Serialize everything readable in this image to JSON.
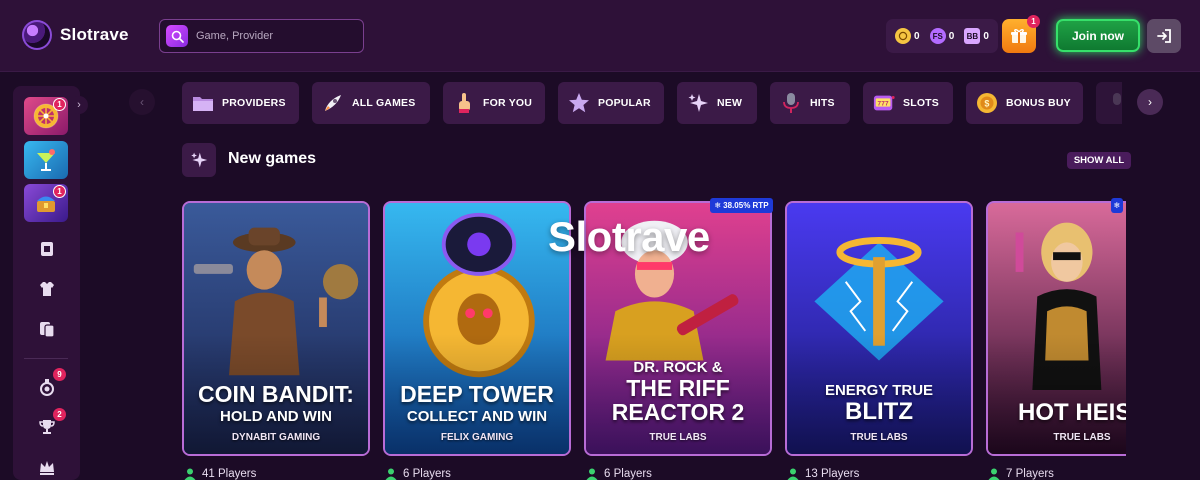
{
  "header": {
    "brand": "Slotrave",
    "search_placeholder": "Game, Provider",
    "currencies": [
      {
        "icon": "coin-icon",
        "value": "0",
        "color": "#f5c542"
      },
      {
        "icon": "freespin-icon",
        "label": "FS",
        "value": "0",
        "color": "#b36bff"
      },
      {
        "icon": "bonus-balance-icon",
        "label": "BB",
        "value": "0",
        "color": "#d9a6ff"
      }
    ],
    "gift_badge": "1",
    "join_label": "Join now"
  },
  "sidebar": {
    "tiles": [
      {
        "name": "wheel",
        "badge": "1",
        "color": "#c0306a"
      },
      {
        "name": "cocktail",
        "badge": "",
        "color": "#2a8fd8"
      },
      {
        "name": "treasure",
        "badge": "1",
        "color": "#6d2fb0"
      }
    ],
    "icons": [
      {
        "name": "card-icon",
        "badge": ""
      },
      {
        "name": "shirt-icon",
        "badge": ""
      },
      {
        "name": "cards-icon",
        "badge": ""
      },
      {
        "name": "medal-icon",
        "badge": "9"
      },
      {
        "name": "trophy-icon",
        "badge": "2"
      },
      {
        "name": "crown-icon",
        "badge": ""
      }
    ]
  },
  "categories": [
    {
      "label": "PROVIDERS",
      "icon": "folder-icon"
    },
    {
      "label": "ALL GAMES",
      "icon": "rocket-icon"
    },
    {
      "label": "FOR YOU",
      "icon": "pointing-hand-icon"
    },
    {
      "label": "POPULAR",
      "icon": "star-icon"
    },
    {
      "label": "NEW",
      "icon": "sparkles-icon"
    },
    {
      "label": "HITS",
      "icon": "microphone-icon"
    },
    {
      "label": "SLOTS",
      "icon": "slot-machine-icon"
    },
    {
      "label": "BONUS BUY",
      "icon": "coin-icon"
    }
  ],
  "section": {
    "title": "New games",
    "show_all": "SHOW ALL"
  },
  "watermark": "Slotrave",
  "games": [
    {
      "title_lines": [
        "COIN BANDIT:",
        "HOLD AND WIN"
      ],
      "provider": "DYNABIT GAMING",
      "players": "41 Players",
      "rtp": "",
      "colors": [
        "#2c4a8a",
        "#0f1a3a"
      ]
    },
    {
      "title_lines": [
        "DEEP TOWER",
        "COLLECT AND WIN"
      ],
      "provider": "FELIX GAMING",
      "players": "6 Players",
      "rtp": "",
      "colors": [
        "#1f9fe0",
        "#0a3f8a"
      ]
    },
    {
      "title_lines": [
        "DR. ROCK &",
        "THE RIFF",
        "REACTOR 2"
      ],
      "provider": "TRUE LABS",
      "players": "6 Players",
      "rtp": "38.05% RTP",
      "colors": [
        "#d2358a",
        "#5a1a8a"
      ]
    },
    {
      "title_lines": [
        "ENERGY TRUE",
        "BLITZ"
      ],
      "provider": "TRUE LABS",
      "players": "13 Players",
      "rtp": "",
      "colors": [
        "#3a3ad8",
        "#12126a"
      ]
    },
    {
      "title_lines": [
        "HOT HEIST"
      ],
      "provider": "TRUE LABS",
      "players": "7 Players",
      "rtp": "",
      "colors": [
        "#c84a8a",
        "#3a0f3a"
      ]
    }
  ],
  "colors": {
    "background": "#1c0b26",
    "panel": "#2e1138",
    "chip": "#3b1a47",
    "accent_green": "#36e06a",
    "badge_red": "#e0245e"
  }
}
